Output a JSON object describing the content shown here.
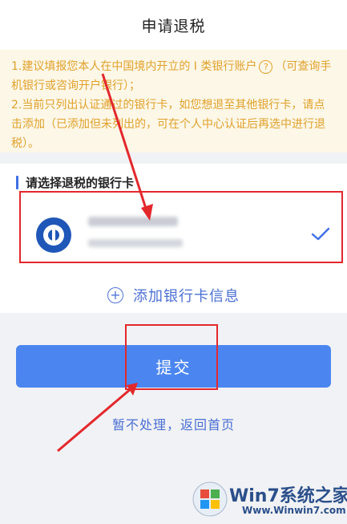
{
  "header": {
    "title": "申请退税"
  },
  "notice": {
    "line1_a": "1.建议填报您本人在中国境内开立的 I 类银行账户",
    "help_glyph": "?",
    "line1_b": "（可查询手机银行或咨询开户银行）；",
    "line2": "2.当前只列出认证通过的银行卡，如您想退至其他银行卡，请点击添加（已添加但未列出的，可在个人中心认证后再选中进行退税）。"
  },
  "bank_section": {
    "title": "请选择退税的银行卡",
    "selected": true,
    "bank_icon": "bank-logo-icon",
    "check_icon": "check-icon"
  },
  "add_card": {
    "label": "添加银行卡信息",
    "icon": "plus-circle-icon"
  },
  "submit": {
    "label": "提交"
  },
  "back": {
    "label": "暂不处理，返回首页"
  },
  "watermark": {
    "brand": "Win7系统之家",
    "url": "Www.Winwin7.com"
  },
  "colors": {
    "accent": "#4b86f0",
    "link": "#4a6fd4",
    "notice_text": "#e0a12b",
    "notice_bg": "#fdf7e7",
    "annotation": "#e3282c"
  }
}
